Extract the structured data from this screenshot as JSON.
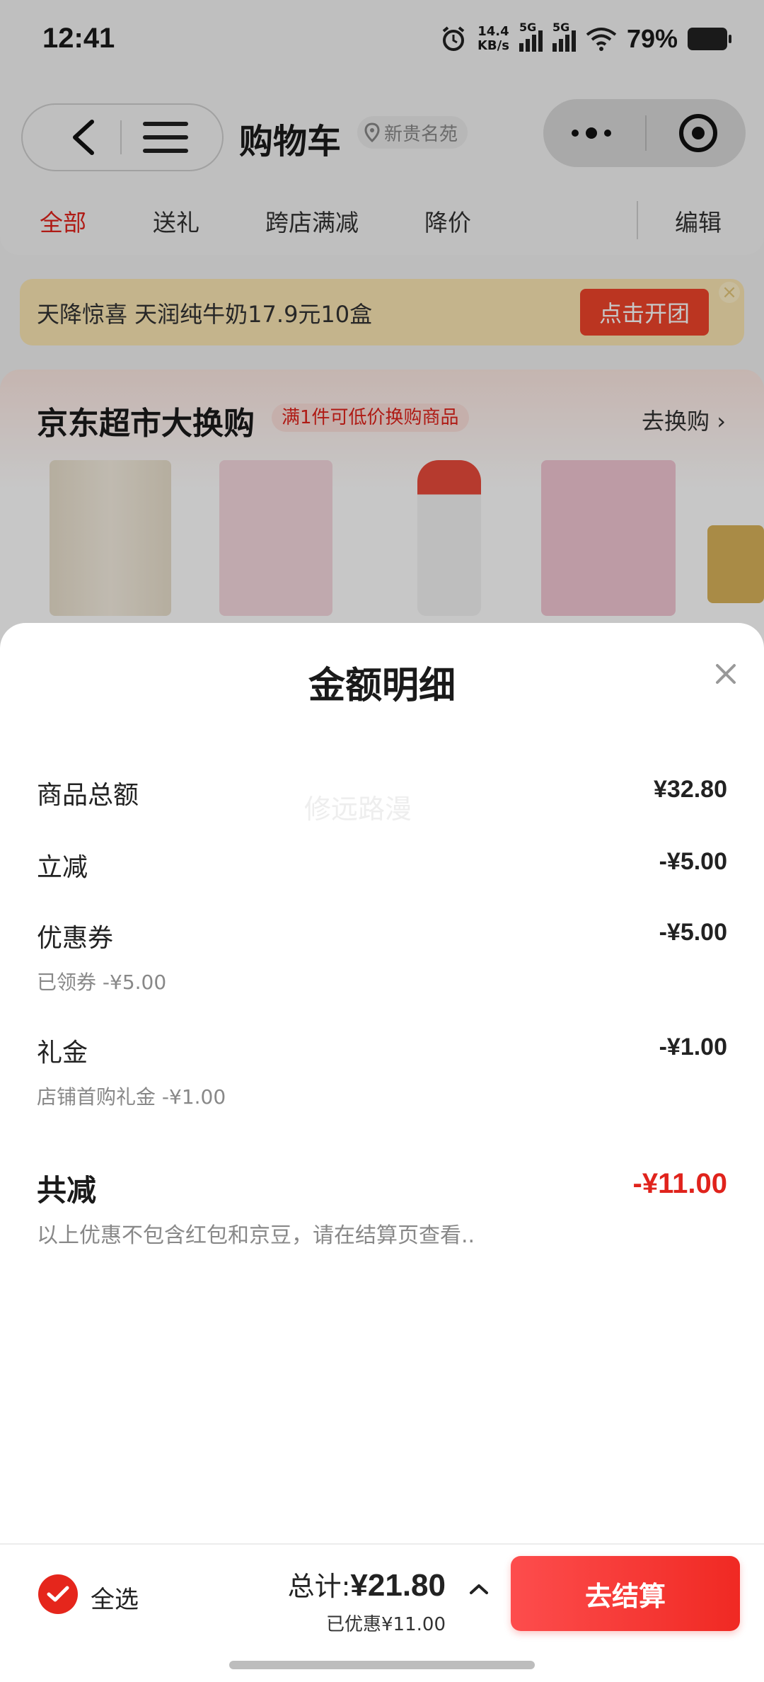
{
  "status": {
    "time": "12:41",
    "speed": "14.4",
    "speed_unit": "KB/s",
    "net1": "5G",
    "net2": "5G",
    "battery": "79%"
  },
  "header": {
    "title": "购物车",
    "location": "新贵名苑"
  },
  "tabs": [
    "全部",
    "送礼",
    "跨店满减",
    "降价"
  ],
  "edit_label": "编辑",
  "promo": {
    "text": "天降惊喜 天润纯牛奶17.9元10盒",
    "button": "点击开团"
  },
  "market": {
    "title": "京东超市大换购",
    "tag": "满1件可低价换购商品",
    "more": "去换购 ›"
  },
  "sheet": {
    "title": "金额明细",
    "watermark": "修远路漫",
    "rows": [
      {
        "label": "商品总额",
        "value": "¥32.80"
      },
      {
        "label": "立减",
        "value": "-¥5.00"
      },
      {
        "label": "优惠券",
        "value": "-¥5.00",
        "sub": "已领券 -¥5.00"
      },
      {
        "label": "礼金",
        "value": "-¥1.00",
        "sub": "店铺首购礼金 -¥1.00"
      }
    ],
    "total_label": "共减",
    "total_value": "-¥11.00",
    "note": "以上优惠不包含红包和京豆，请在结算页查看.."
  },
  "bottom": {
    "select_all": "全选",
    "total_prefix": "总计:",
    "total_value": "¥21.80",
    "saved": "已优惠¥11.00",
    "checkout": "去结算"
  },
  "colors": {
    "accent": "#e0231c",
    "checkout": "#f02923",
    "promo_bg": "#fbe7b4"
  }
}
